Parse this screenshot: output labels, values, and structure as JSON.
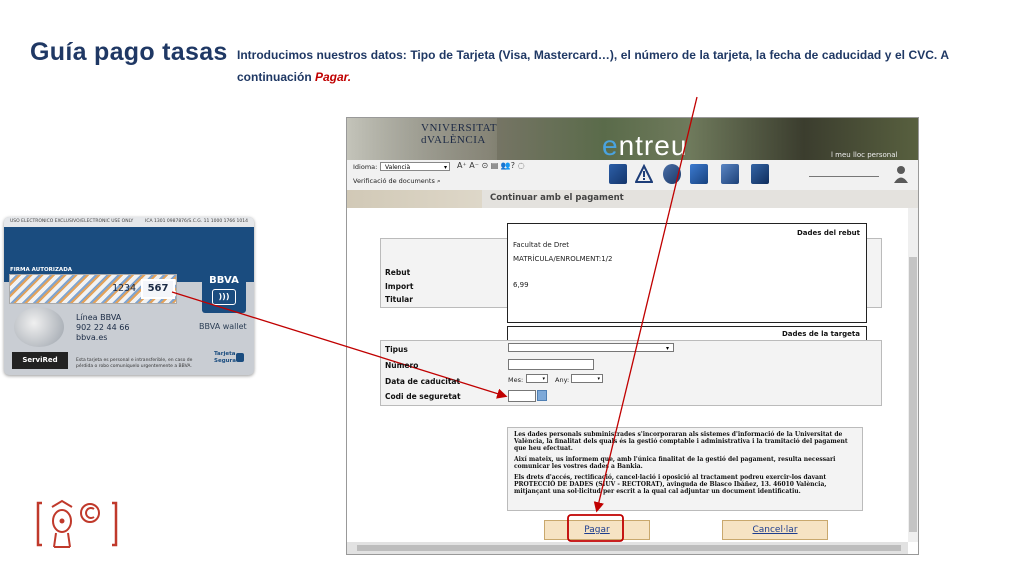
{
  "slide": {
    "title": "Guía pago tasas",
    "intro_text": "Introducimos nuestros datos: Tipo de Tarjeta (Visa, Mastercard…), el número de la tarjeta, la fecha de caducidad y el CVC. A continuación ",
    "intro_highlight": "Pagar."
  },
  "card": {
    "top_left": "USO ELECTRONICO EXCLUSIVO/ELECTRONIC USE ONLY",
    "top_right": "ICA 1301 0987876/S.C.G. 11 1000 1766 1014",
    "signature_label": "FIRMA AUTORIZADA",
    "number_fragment": "1234",
    "cvc": "567",
    "brand": "BBVA",
    "wallet": "BBVA wallet",
    "linea_title": "Línea BBVA",
    "linea_phone": "902 22 44 66",
    "linea_site": "bbva.es",
    "servired": "ServiRed",
    "fine_print": "Esta tarjeta es personal e intransferible, en caso de pérdida o robo comuníquelo urgentemente a BBVA.",
    "secure_line1": "Tarjeta",
    "secure_line2": "Segura"
  },
  "browser": {
    "university_line1": "VNIVERSITAT",
    "university_line2": "dVALÈNCIA",
    "app_name_first": "e",
    "app_name_rest": "ntreu",
    "tagline": "l meu lloc personal",
    "idioma_label": "Idioma:",
    "idioma_value": "Valencià",
    "text_tools": "A⁺ A⁻ ⊙ ▤ 👥? ◌",
    "verificacio": "Verificació de documents",
    "section_title": "Continuar amb el pagament",
    "rebut": {
      "title": "Dades del rebut",
      "facultat": "Facultat de Dret",
      "matricula": "MATRÍCULA/ENROLMENT:1/2",
      "import": "6,99",
      "label_rebut": "Rebut",
      "label_import": "Import",
      "label_titular": "Titular"
    },
    "targeta": {
      "title": "Dades de la targeta",
      "label_tipus": "Tipus",
      "label_numero": "Número",
      "label_data": "Data de caducitat",
      "label_codi": "Codi de seguretat",
      "mes_label": "Mes:",
      "any_label": "Any:"
    },
    "legal": {
      "p1": "Les dades personals subministrades s'incorporaran als sistemes d'informació de la Universitat de València, la finalitat dels quals és la gestió comptable i administrativa i la tramitació del pagament que heu efectuat.",
      "p2": "Així mateix, us informem que, amb l'única finalitat de la gestió del pagament, resulta necessari comunicar les vostres dades a Bankia.",
      "p3": "Els drets d'accés, rectificació, cancel·lació i oposició al tractament podreu exercir-los davant PROTECCIÓ DE DADES (SIUV - RECTORAT), avinguda de Blasco Ibáñez, 13. 46010 València, mitjançant una sol·licitud per escrit a la qual cal adjuntar un document identificatiu."
    },
    "buttons": {
      "pagar": "Pagar",
      "cancel": "Cancel·lar"
    }
  },
  "colors": {
    "title_blue": "#1f3864",
    "highlight_red": "#c00000",
    "arrow_red": "#c00000"
  }
}
